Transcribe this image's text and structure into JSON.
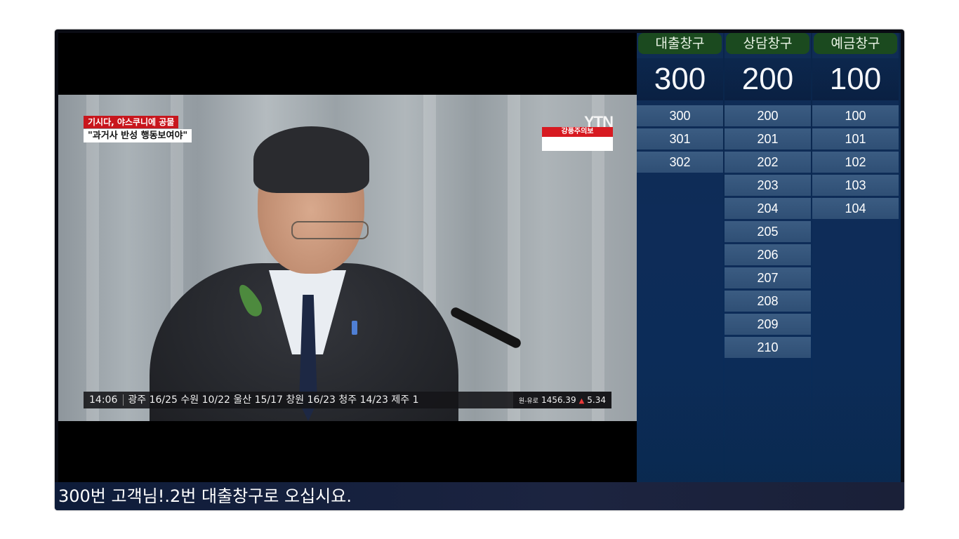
{
  "video": {
    "headline_red": "기시다, 야스쿠니에 공물",
    "headline_quote": "\"과거사 반성 행동보여야\"",
    "logo": "YTN",
    "alert_label": "강풍주의보",
    "ticker": {
      "time": "14:06",
      "text": "광주 16/25   수원 10/22   울산 15/17   창원 16/23   청주 14/23   제주 1",
      "fx_label": "원-유로",
      "fx_value": "1456.39",
      "fx_change": "5.34"
    }
  },
  "queue": {
    "columns": [
      {
        "title": "대출창구",
        "current": "300",
        "waiting": [
          "300",
          "301",
          "302"
        ]
      },
      {
        "title": "상담창구",
        "current": "200",
        "waiting": [
          "200",
          "201",
          "202",
          "203",
          "204",
          "205",
          "206",
          "207",
          "208",
          "209",
          "210"
        ]
      },
      {
        "title": "예금창구",
        "current": "100",
        "waiting": [
          "100",
          "101",
          "102",
          "103",
          "104"
        ]
      }
    ]
  },
  "banner": {
    "message": "300번 고객님!.2번 대출창구로 오십시요."
  },
  "colors": {
    "header_green": "#1b4a1f",
    "ticket_blue": "#3b5c82",
    "panel_navy": "#0a2448",
    "news_red": "#c8161d"
  }
}
